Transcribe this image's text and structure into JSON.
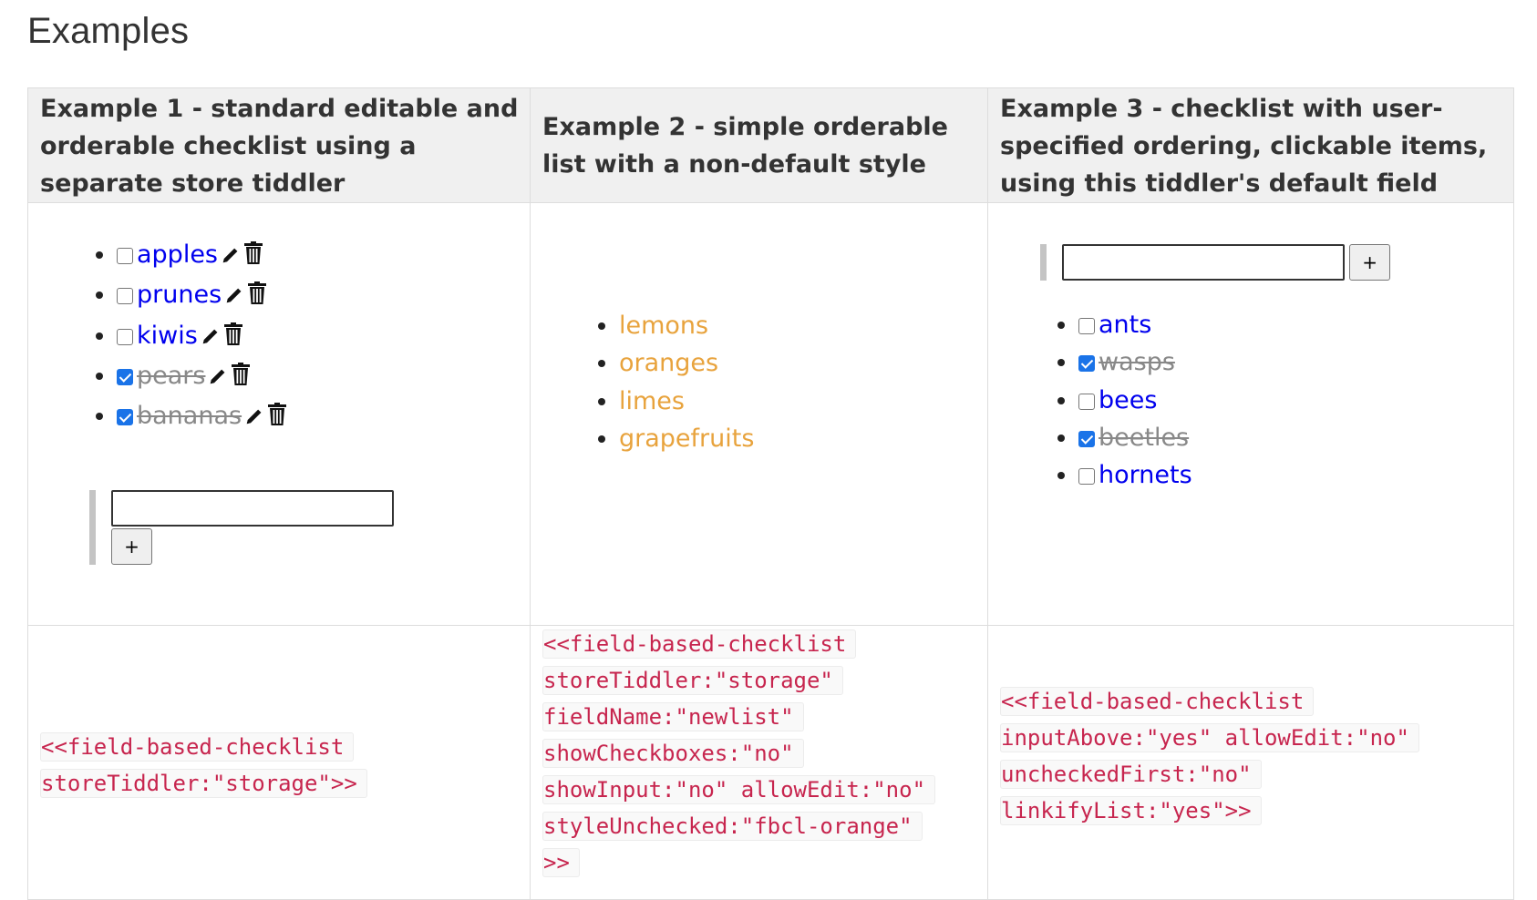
{
  "page": {
    "heading": "Examples"
  },
  "headers": [
    "Example 1 - standard editable and orderable checklist using a separate store tiddler",
    "Example 2 - simple orderable list with a non-default style",
    "Example 3 - checklist with user-specified ordering, clickable items, using this tiddler's default field"
  ],
  "example1": {
    "items": [
      {
        "label": "apples",
        "checked": false
      },
      {
        "label": "prunes",
        "checked": false
      },
      {
        "label": "kiwis",
        "checked": false
      },
      {
        "label": "pears",
        "checked": true
      },
      {
        "label": "bananas",
        "checked": true
      }
    ],
    "edit_icon": "pencil-icon",
    "delete_icon": "trash-icon",
    "input_value": "",
    "add_label": "+"
  },
  "example2": {
    "items": [
      "lemons",
      "oranges",
      "limes",
      "grapefruits"
    ],
    "item_color": "#e8a33d"
  },
  "example3": {
    "input_value": "",
    "add_label": "+",
    "items": [
      {
        "label": "ants",
        "checked": false
      },
      {
        "label": "wasps",
        "checked": true
      },
      {
        "label": "bees",
        "checked": false
      },
      {
        "label": "beetles",
        "checked": true
      },
      {
        "label": "hornets",
        "checked": false
      }
    ]
  },
  "code": {
    "ex1": [
      "<<field-based-checklist",
      "storeTiddler:\"storage\">>"
    ],
    "ex2": [
      "<<field-based-checklist",
      "storeTiddler:\"storage\"",
      "fieldName:\"newlist\"",
      "showCheckboxes:\"no\"",
      "showInput:\"no\" allowEdit:\"no\"",
      "styleUnchecked:\"fbcl-orange\"",
      ">>"
    ],
    "ex3": [
      "<<field-based-checklist",
      "inputAbove:\"yes\" allowEdit:\"no\"",
      "uncheckedFirst:\"no\"",
      "linkifyList:\"yes\">>"
    ]
  },
  "colors": {
    "link": "#0000ee",
    "done": "#888888",
    "code": "#c7254e",
    "checkbox": "#1a73e8"
  }
}
